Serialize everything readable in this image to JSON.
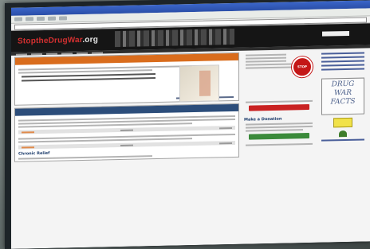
{
  "browser": {
    "window_title": "",
    "address": ""
  },
  "site": {
    "logo_main": "StoptheDrugWar",
    "logo_tld": ".org"
  },
  "panels": {
    "latest_title": "",
    "latest_item_title": "",
    "blog_title": "",
    "blog_items": [
      {
        "title": ""
      },
      {
        "title": ""
      },
      {
        "title": "Chronic Relief"
      }
    ]
  },
  "sidebar": {
    "stop_badge": "STOP",
    "blocks": [
      {
        "title": ""
      },
      {
        "title": ""
      },
      {
        "title": "Make a Donation"
      },
      {
        "title": ""
      }
    ]
  },
  "right_column": {
    "title": "",
    "dwf_lines": [
      "DRUG",
      "WAR",
      "FACTS"
    ],
    "bottom_title": ""
  },
  "colors": {
    "brand_red": "#d23030",
    "orange_header": "#d96c1c",
    "blue_header": "#2c4d7a"
  },
  "icons": [
    "stop-sign-icon",
    "marijuana-leaf-icon"
  ]
}
